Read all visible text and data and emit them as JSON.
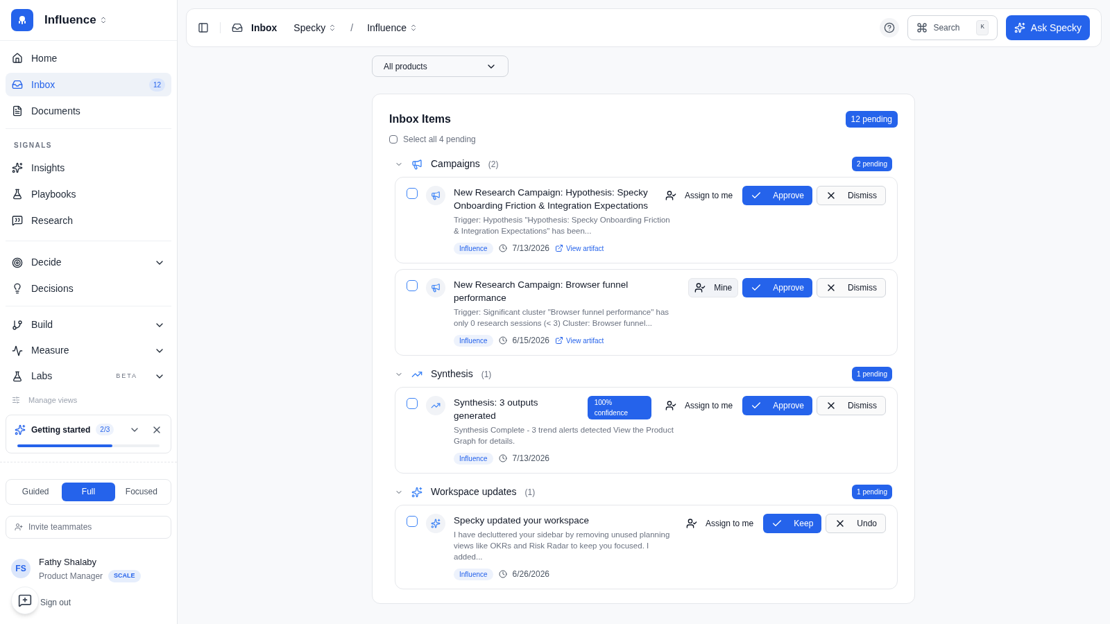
{
  "workspace": {
    "name": "Influence"
  },
  "nav": [
    {
      "label": "Home",
      "selected": false
    },
    {
      "label": "Inbox",
      "selected": true,
      "badge": "12"
    },
    {
      "label": "Documents",
      "selected": false
    }
  ],
  "signals": {
    "heading": "SIGNALS",
    "items": [
      {
        "label": "Insights"
      },
      {
        "label": "Playbooks"
      },
      {
        "label": "Research"
      }
    ]
  },
  "decide": [
    {
      "label": "Decide",
      "expanded": false
    },
    {
      "label": "Decisions"
    }
  ],
  "groups": [
    {
      "label": "Build",
      "expanded": false
    },
    {
      "label": "Measure",
      "expanded": false
    },
    {
      "label": "Labs",
      "expanded": false,
      "tag": "BETA"
    }
  ],
  "manage_views": "Manage views",
  "getting_started": {
    "title": "Getting started",
    "count": "2/3",
    "level": 0.67
  },
  "modes": [
    {
      "label": "Guided",
      "selected": false
    },
    {
      "label": "Full",
      "selected": true
    },
    {
      "label": "Focused",
      "selected": false
    }
  ],
  "invite": "Invite teammates",
  "user": {
    "initials": "FS",
    "name": "Fathy Shalaby",
    "role": "Product Manager",
    "plan": "SCALE",
    "sign_out": "Sign out"
  },
  "header": {
    "page": "Inbox",
    "crumbs": [
      "Specky",
      "Influence"
    ],
    "separator": "/",
    "search": "Search",
    "shortcut": "K",
    "ask": "Ask Specky"
  },
  "filter": "All products",
  "inbox": {
    "title": "Inbox Items",
    "pending": "12 pending",
    "select_all": "Select all 4 pending",
    "select_all_checked": false,
    "sections": [
      {
        "title": "Campaigns",
        "count": "(2)",
        "pending": "2 pending",
        "expanded": true,
        "items": [
          {
            "title": "New Research Campaign: Hypothesis: Specky Onboarding Friction & Integration Expectations",
            "desc": "Trigger: Hypothesis \"Hypothesis: Specky Onboarding Friction & Integration Expectations\" has been...",
            "tag": "Influence",
            "date": "7/13/2026",
            "link": "View artifact",
            "assign": "Assign to me",
            "assigned": false,
            "approve": "Approve",
            "dismiss": "Dismiss",
            "checked": false
          },
          {
            "title": "New Research Campaign: Browser funnel performance",
            "desc": "Trigger: Significant cluster \"Browser funnel performance\" has only 0 research sessions (< 3) Cluster: Browser funnel...",
            "tag": "Influence",
            "date": "6/15/2026",
            "link": "View artifact",
            "assign": "Mine",
            "assigned": true,
            "approve": "Approve",
            "dismiss": "Dismiss",
            "checked": false
          }
        ]
      },
      {
        "title": "Synthesis",
        "count": "(1)",
        "pending": "1 pending",
        "expanded": true,
        "items": [
          {
            "title": "Synthesis: 3 outputs generated",
            "confidence": "100% confidence",
            "desc": "Synthesis Complete - 3 trend alerts detected View the Product Graph for details.",
            "tag": "Influence",
            "date": "7/13/2026",
            "assign": "Assign to me",
            "assigned": false,
            "approve": "Approve",
            "dismiss": "Dismiss",
            "checked": false
          }
        ]
      },
      {
        "title": "Workspace updates",
        "count": "(1)",
        "pending": "1 pending",
        "expanded": true,
        "items": [
          {
            "title": "Specky updated your workspace",
            "desc": "I have decluttered your sidebar by removing unused planning views like OKRs and Risk Radar to keep you focused. I added...",
            "tag": "Influence",
            "date": "6/26/2026",
            "assign": "Assign to me",
            "assigned": false,
            "approve": "Keep",
            "dismiss": "Undo",
            "checked": false
          }
        ]
      }
    ]
  }
}
